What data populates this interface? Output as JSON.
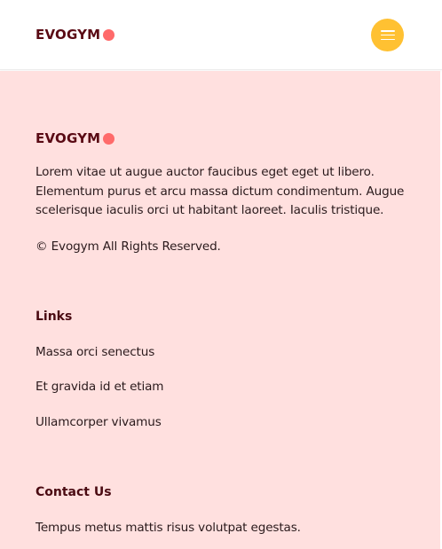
{
  "header": {
    "logo_text": "EVOGYM",
    "menu_icon": "hamburger-menu-icon"
  },
  "footer": {
    "logo_text": "EVOGYM",
    "about": "Lorem vitae ut augue auctor faucibus eget eget ut libero. Elementum purus et arcu massa dictum condimentum. Augue scelerisque iaculis orci ut habitant laoreet. Iaculis tristique.",
    "copyright": "© Evogym All Rights Reserved.",
    "links_title": "Links",
    "links": [
      "Massa orci senectus",
      "Et gravida id et etiam",
      "Ullamcorper vivamus"
    ],
    "contact_title": "Contact Us",
    "contact_text": "Tempus metus mattis risus volutpat egestas."
  },
  "colors": {
    "brand": "#5a0a14",
    "logo_dot": "#ff6a6a",
    "menu_button": "#ffc132",
    "footer_background": "#ffe0df"
  }
}
